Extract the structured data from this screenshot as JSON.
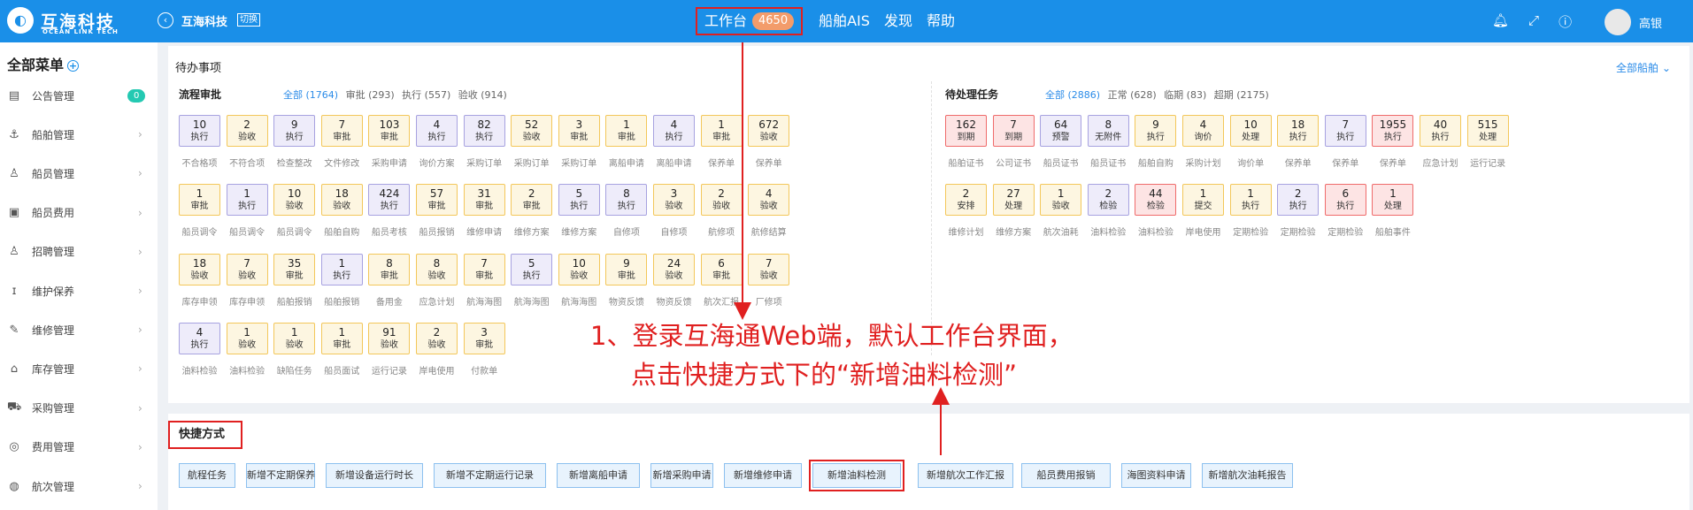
{
  "topbar": {
    "logo_cn": "互海科技",
    "logo_en": "OCEAN LINK TECH",
    "company": "互海科技",
    "switch_label": "切换",
    "nav": [
      {
        "label": "工作台",
        "badge": "4650"
      },
      {
        "label": "船舶AIS"
      },
      {
        "label": "发现"
      },
      {
        "label": "帮助"
      }
    ],
    "user": "高银"
  },
  "sidebar": {
    "title": "全部菜单",
    "items": [
      {
        "label": "公告管理",
        "badge": "0",
        "icon": "notice-icon"
      },
      {
        "label": "船舶管理",
        "icon": "anchor-icon"
      },
      {
        "label": "船员管理",
        "icon": "person-icon"
      },
      {
        "label": "船员费用",
        "icon": "wallet-icon"
      },
      {
        "label": "招聘管理",
        "icon": "recruit-icon"
      },
      {
        "label": "维护保养",
        "icon": "maintenance-icon"
      },
      {
        "label": "维修管理",
        "icon": "wrench-icon"
      },
      {
        "label": "库存管理",
        "icon": "warehouse-icon"
      },
      {
        "label": "采购管理",
        "icon": "cart-icon"
      },
      {
        "label": "费用管理",
        "icon": "database-icon"
      },
      {
        "label": "航次管理",
        "icon": "globe-icon"
      }
    ]
  },
  "todo": {
    "title": "待办事项",
    "all_ships": "全部船舶",
    "approval": {
      "title": "流程审批",
      "filters": [
        "全部 (1764)",
        "审批 (293)",
        "执行 (557)",
        "验收 (914)"
      ],
      "cards": [
        {
          "n": "10",
          "t": "执行",
          "name": "不合格项",
          "c": "blue"
        },
        {
          "n": "2",
          "t": "验收",
          "name": "不符合项",
          "c": "yellow"
        },
        {
          "n": "9",
          "t": "执行",
          "name": "检查整改",
          "c": "blue"
        },
        {
          "n": "7",
          "t": "审批",
          "name": "文件修改",
          "c": "yellow"
        },
        {
          "n": "103",
          "t": "审批",
          "name": "采购申请",
          "c": "yellow"
        },
        {
          "n": "4",
          "t": "执行",
          "name": "询价方案",
          "c": "blue"
        },
        {
          "n": "82",
          "t": "执行",
          "name": "采购订单",
          "c": "blue"
        },
        {
          "n": "52",
          "t": "验收",
          "name": "采购订单",
          "c": "yellow"
        },
        {
          "n": "3",
          "t": "审批",
          "name": "采购订单",
          "c": "yellow"
        },
        {
          "n": "1",
          "t": "审批",
          "name": "离船申请",
          "c": "yellow"
        },
        {
          "n": "4",
          "t": "执行",
          "name": "离船申请",
          "c": "blue"
        },
        {
          "n": "1",
          "t": "审批",
          "name": "保养单",
          "c": "yellow"
        },
        {
          "n": "672",
          "t": "验收",
          "name": "保养单",
          "c": "yellow"
        },
        {
          "n": "1",
          "t": "审批",
          "name": "船员调令",
          "c": "yellow"
        },
        {
          "n": "1",
          "t": "执行",
          "name": "船员调令",
          "c": "blue"
        },
        {
          "n": "10",
          "t": "验收",
          "name": "船员调令",
          "c": "yellow"
        },
        {
          "n": "18",
          "t": "验收",
          "name": "船舶自购",
          "c": "yellow"
        },
        {
          "n": "424",
          "t": "执行",
          "name": "船员考核",
          "c": "blue"
        },
        {
          "n": "57",
          "t": "审批",
          "name": "船员报销",
          "c": "yellow"
        },
        {
          "n": "31",
          "t": "审批",
          "name": "维修申请",
          "c": "yellow"
        },
        {
          "n": "2",
          "t": "审批",
          "name": "维修方案",
          "c": "yellow"
        },
        {
          "n": "5",
          "t": "执行",
          "name": "维修方案",
          "c": "blue"
        },
        {
          "n": "8",
          "t": "执行",
          "name": "自修项",
          "c": "blue"
        },
        {
          "n": "3",
          "t": "验收",
          "name": "自修项",
          "c": "yellow"
        },
        {
          "n": "2",
          "t": "验收",
          "name": "航修项",
          "c": "yellow"
        },
        {
          "n": "4",
          "t": "验收",
          "name": "航修结算",
          "c": "yellow"
        },
        {
          "n": "18",
          "t": "验收",
          "name": "库存申领",
          "c": "yellow"
        },
        {
          "n": "7",
          "t": "验收",
          "name": "库存申领",
          "c": "yellow"
        },
        {
          "n": "35",
          "t": "审批",
          "name": "船舶报销",
          "c": "yellow"
        },
        {
          "n": "1",
          "t": "执行",
          "name": "船舶报销",
          "c": "blue"
        },
        {
          "n": "8",
          "t": "审批",
          "name": "备用金",
          "c": "yellow"
        },
        {
          "n": "8",
          "t": "验收",
          "name": "应急计划",
          "c": "yellow"
        },
        {
          "n": "7",
          "t": "审批",
          "name": "航海海图",
          "c": "yellow"
        },
        {
          "n": "5",
          "t": "执行",
          "name": "航海海图",
          "c": "blue"
        },
        {
          "n": "10",
          "t": "验收",
          "name": "航海海图",
          "c": "yellow"
        },
        {
          "n": "9",
          "t": "审批",
          "name": "物资反馈",
          "c": "yellow"
        },
        {
          "n": "24",
          "t": "验收",
          "name": "物资反馈",
          "c": "yellow"
        },
        {
          "n": "6",
          "t": "审批",
          "name": "航次汇报",
          "c": "yellow"
        },
        {
          "n": "7",
          "t": "验收",
          "name": "厂修项",
          "c": "yellow"
        },
        {
          "n": "4",
          "t": "执行",
          "name": "油料检验",
          "c": "blue"
        },
        {
          "n": "1",
          "t": "验收",
          "name": "油料检验",
          "c": "yellow"
        },
        {
          "n": "1",
          "t": "验收",
          "name": "缺陷任务",
          "c": "yellow"
        },
        {
          "n": "1",
          "t": "审批",
          "name": "船员面试",
          "c": "yellow"
        },
        {
          "n": "91",
          "t": "验收",
          "name": "运行记录",
          "c": "yellow"
        },
        {
          "n": "2",
          "t": "验收",
          "name": "岸电使用",
          "c": "yellow"
        },
        {
          "n": "3",
          "t": "审批",
          "name": "付款单",
          "c": "yellow"
        }
      ]
    },
    "tasks": {
      "title": "待处理任务",
      "filters": [
        "全部 (2886)",
        "正常 (628)",
        "临期 (83)",
        "超期 (2175)"
      ],
      "cards": [
        {
          "n": "162",
          "t": "到期",
          "name": "船舶证书",
          "c": "red"
        },
        {
          "n": "7",
          "t": "到期",
          "name": "公司证书",
          "c": "red"
        },
        {
          "n": "64",
          "t": "预警",
          "name": "船员证书",
          "c": "blue"
        },
        {
          "n": "8",
          "t": "无附件",
          "name": "船员证书",
          "c": "blue"
        },
        {
          "n": "9",
          "t": "执行",
          "name": "船舶自购",
          "c": "yellow"
        },
        {
          "n": "4",
          "t": "询价",
          "name": "采购计划",
          "c": "yellow"
        },
        {
          "n": "10",
          "t": "处理",
          "name": "询价单",
          "c": "yellow"
        },
        {
          "n": "18",
          "t": "执行",
          "name": "保养单",
          "c": "yellow"
        },
        {
          "n": "7",
          "t": "执行",
          "name": "保养单",
          "c": "blue"
        },
        {
          "n": "1955",
          "t": "执行",
          "name": "保养单",
          "c": "red"
        },
        {
          "n": "40",
          "t": "执行",
          "name": "应急计划",
          "c": "yellow"
        },
        {
          "n": "515",
          "t": "处理",
          "name": "运行记录",
          "c": "yellow"
        },
        {
          "n": "2",
          "t": "安排",
          "name": "维修计划",
          "c": "yellow"
        },
        {
          "n": "27",
          "t": "处理",
          "name": "维修方案",
          "c": "yellow"
        },
        {
          "n": "1",
          "t": "验收",
          "name": "航次油耗",
          "c": "yellow"
        },
        {
          "n": "2",
          "t": "检验",
          "name": "油料检验",
          "c": "blue"
        },
        {
          "n": "44",
          "t": "检验",
          "name": "油料检验",
          "c": "red"
        },
        {
          "n": "1",
          "t": "提交",
          "name": "岸电使用",
          "c": "yellow"
        },
        {
          "n": "1",
          "t": "执行",
          "name": "定期检验",
          "c": "yellow"
        },
        {
          "n": "2",
          "t": "执行",
          "name": "定期检验",
          "c": "blue"
        },
        {
          "n": "6",
          "t": "执行",
          "name": "定期检验",
          "c": "red"
        },
        {
          "n": "1",
          "t": "处理",
          "name": "船舶事件",
          "c": "red"
        }
      ]
    }
  },
  "quick": {
    "title": "快捷方式",
    "buttons": [
      "航程任务",
      "新增不定期保养",
      "新增设备运行时长",
      "新增不定期运行记录",
      "新增离船申请",
      "新增采购申请",
      "新增维修申请",
      "新增油料检测",
      "新增航次工作汇报",
      "船员费用报销",
      "海图资料申请",
      "新增航次油耗报告"
    ],
    "highlighted": "新增油料检测"
  },
  "annotation": {
    "line1": "1、登录互海通Web端，默认工作台界面，",
    "line2": "点击快捷方式下的“新增油料检测”"
  },
  "colors": {
    "brand": "#1a8fe8",
    "annotation": "#e02020",
    "card_yellow_border": "#f3c75a",
    "card_blue_border": "#a7a2e0",
    "card_red_border": "#ef6b6b"
  }
}
